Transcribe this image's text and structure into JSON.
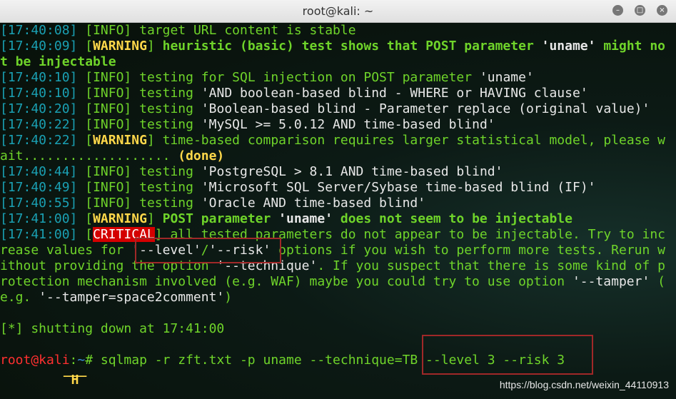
{
  "window": {
    "title": "root@kali: ~",
    "buttons": [
      "minimize",
      "maximize",
      "close"
    ]
  },
  "lines": [
    [
      [
        "ts",
        "[17:40:08]"
      ],
      [
        "br",
        " ["
      ],
      [
        "info",
        "INFO"
      ],
      [
        "br",
        "] "
      ],
      [
        "txt",
        "target URL content is stable"
      ]
    ],
    [
      [
        "ts",
        "[17:40:09]"
      ],
      [
        "br",
        " ["
      ],
      [
        "warn",
        "WARNING"
      ],
      [
        "br",
        "] "
      ],
      [
        "bold",
        "heuristic (basic) test shows that POST parameter "
      ],
      [
        "qb",
        "'uname'"
      ],
      [
        "bold",
        " might no"
      ]
    ],
    [
      [
        "bold",
        "t be injectable"
      ]
    ],
    [
      [
        "ts",
        "[17:40:10]"
      ],
      [
        "br",
        " ["
      ],
      [
        "info",
        "INFO"
      ],
      [
        "br",
        "] "
      ],
      [
        "txt",
        "testing for SQL injection on POST parameter "
      ],
      [
        "q",
        "'uname'"
      ]
    ],
    [
      [
        "ts",
        "[17:40:10]"
      ],
      [
        "br",
        " ["
      ],
      [
        "info",
        "INFO"
      ],
      [
        "br",
        "] "
      ],
      [
        "txt",
        "testing "
      ],
      [
        "q",
        "'AND boolean-based blind - WHERE or HAVING clause'"
      ]
    ],
    [
      [
        "ts",
        "[17:40:20]"
      ],
      [
        "br",
        " ["
      ],
      [
        "info",
        "INFO"
      ],
      [
        "br",
        "] "
      ],
      [
        "txt",
        "testing "
      ],
      [
        "q",
        "'Boolean-based blind - Parameter replace (original value)'"
      ]
    ],
    [
      [
        "ts",
        "[17:40:22]"
      ],
      [
        "br",
        " ["
      ],
      [
        "info",
        "INFO"
      ],
      [
        "br",
        "] "
      ],
      [
        "txt",
        "testing "
      ],
      [
        "q",
        "'MySQL >= 5.0.12 AND time-based blind'"
      ]
    ],
    [
      [
        "ts",
        "[17:40:22]"
      ],
      [
        "br",
        " ["
      ],
      [
        "warn",
        "WARNING"
      ],
      [
        "br",
        "] "
      ],
      [
        "txt",
        "time-based comparison requires larger statistical model, please w"
      ]
    ],
    [
      [
        "txt",
        "ait................... "
      ],
      [
        "warn",
        "(done)"
      ]
    ],
    [
      [
        "ts",
        "[17:40:44]"
      ],
      [
        "br",
        " ["
      ],
      [
        "info",
        "INFO"
      ],
      [
        "br",
        "] "
      ],
      [
        "txt",
        "testing "
      ],
      [
        "q",
        "'PostgreSQL > 8.1 AND time-based blind'"
      ]
    ],
    [
      [
        "ts",
        "[17:40:49]"
      ],
      [
        "br",
        " ["
      ],
      [
        "info",
        "INFO"
      ],
      [
        "br",
        "] "
      ],
      [
        "txt",
        "testing "
      ],
      [
        "q",
        "'Microsoft SQL Server/Sybase time-based blind (IF)'"
      ]
    ],
    [
      [
        "ts",
        "[17:40:55]"
      ],
      [
        "br",
        " ["
      ],
      [
        "info",
        "INFO"
      ],
      [
        "br",
        "] "
      ],
      [
        "txt",
        "testing "
      ],
      [
        "q",
        "'Oracle AND time-based blind'"
      ]
    ],
    [
      [
        "ts",
        "[17:41:00]"
      ],
      [
        "br",
        " ["
      ],
      [
        "warn",
        "WARNING"
      ],
      [
        "br",
        "] "
      ],
      [
        "bold",
        "POST parameter "
      ],
      [
        "qb",
        "'uname'"
      ],
      [
        "bold",
        " does not seem to be injectable"
      ]
    ],
    [
      [
        "ts",
        "[17:41:00]"
      ],
      [
        "br",
        " ["
      ],
      [
        "crit",
        "CRITICAL"
      ],
      [
        "br",
        "] "
      ],
      [
        "txt",
        "all tested parameters do not appear to be injectable. Try to inc"
      ]
    ],
    [
      [
        "txt",
        "rease values for "
      ],
      [
        "q",
        "'--level'"
      ],
      [
        "txt",
        "/"
      ],
      [
        "q",
        "'--risk'"
      ],
      [
        "txt",
        " options if you wish to perform more tests. Rerun w"
      ]
    ],
    [
      [
        "txt",
        "ithout providing the option "
      ],
      [
        "q",
        "'--technique'"
      ],
      [
        "txt",
        ". If you suspect that there is some kind of p"
      ]
    ],
    [
      [
        "txt",
        "rotection mechanism involved (e.g. WAF) maybe you could try to use option "
      ],
      [
        "q",
        "'--tamper'"
      ],
      [
        "txt",
        " ("
      ]
    ],
    [
      [
        "txt",
        "e.g. "
      ],
      [
        "q",
        "'--tamper=space2comment'"
      ],
      [
        "txt",
        ")"
      ]
    ],
    [],
    [
      [
        "txt",
        "[*] shutting down at 17:41:00"
      ]
    ],
    [],
    [
      [
        "red",
        "root@kali"
      ],
      [
        "txt",
        ":"
      ],
      [
        "blue",
        "~"
      ],
      [
        "txt",
        "# sqlmap -r zft.txt -p uname --technique=TB --level 3 --risk 3"
      ]
    ]
  ],
  "logo": " ___\n  H\n",
  "watermark": "https://blog.csdn.net/weixin_44110913"
}
